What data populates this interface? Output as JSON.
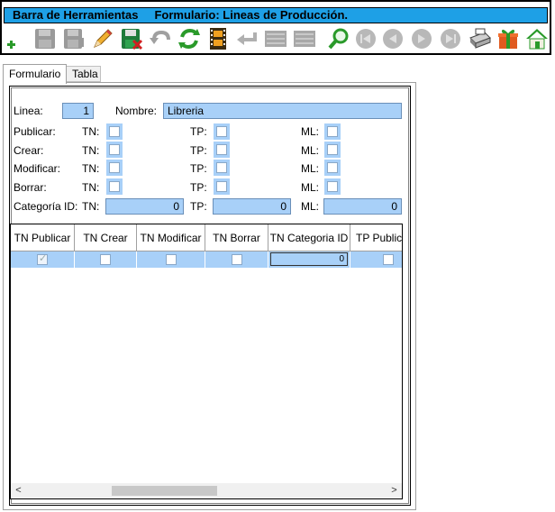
{
  "toolbar": {
    "title": "Barra de Herramientas",
    "subtitle": "Formulario: Lineas de Producción.",
    "buttons": [
      {
        "icon": "add-icon",
        "enabled": true
      },
      {
        "icon": "save-icon",
        "enabled": false
      },
      {
        "icon": "save-as-icon",
        "enabled": false
      },
      {
        "icon": "edit-pencil-icon",
        "enabled": true
      },
      {
        "icon": "save-delete-icon",
        "enabled": true
      },
      {
        "icon": "undo-icon",
        "enabled": false
      },
      {
        "icon": "refresh-icon",
        "enabled": true
      },
      {
        "icon": "film-icon",
        "enabled": true
      },
      {
        "icon": "return-icon",
        "enabled": false
      },
      {
        "icon": "list-icon",
        "enabled": false
      },
      {
        "icon": "list-icon",
        "enabled": false
      },
      {
        "icon": "search-magnifier-icon",
        "enabled": true
      },
      {
        "icon": "first-record-icon",
        "enabled": false
      },
      {
        "icon": "previous-record-icon",
        "enabled": false
      },
      {
        "icon": "next-record-icon",
        "enabled": false
      },
      {
        "icon": "last-record-icon",
        "enabled": false
      },
      {
        "icon": "printer-icon",
        "enabled": true
      },
      {
        "icon": "gift-icon",
        "enabled": true
      },
      {
        "icon": "home-icon",
        "enabled": true
      }
    ],
    "colors": {
      "title_bg": "#1ea0e6",
      "field_bg": "#a8d0f8"
    }
  },
  "tabs": [
    {
      "label": "Formulario",
      "active": true
    },
    {
      "label": "Tabla",
      "active": false
    }
  ],
  "form": {
    "linea_label": "Linea:",
    "linea_value": "1",
    "nombre_label": "Nombre:",
    "nombre_value": "Libreria",
    "tn_label": "TN:",
    "tp_label": "TP:",
    "ml_label": "ML:",
    "rows": [
      {
        "label": "Publicar:"
      },
      {
        "label": "Crear:"
      },
      {
        "label": "Modificar:"
      },
      {
        "label": "Borrar:"
      }
    ],
    "categoria_label": "Categoría ID:",
    "categoria_tn": "0",
    "categoria_tp": "0",
    "categoria_ml": "0"
  },
  "grid": {
    "columns": [
      "TN Publicar",
      "TN Crear",
      "TN Modificar",
      "TN Borrar",
      "TN Categoria ID",
      "TP Publicar"
    ],
    "row": {
      "tn_publicar": true,
      "tn_crear": false,
      "tn_modificar": false,
      "tn_borrar": false,
      "tn_categoria_id": "0",
      "tp_publicar": false
    },
    "scroll_left": "<",
    "scroll_right": ">"
  }
}
